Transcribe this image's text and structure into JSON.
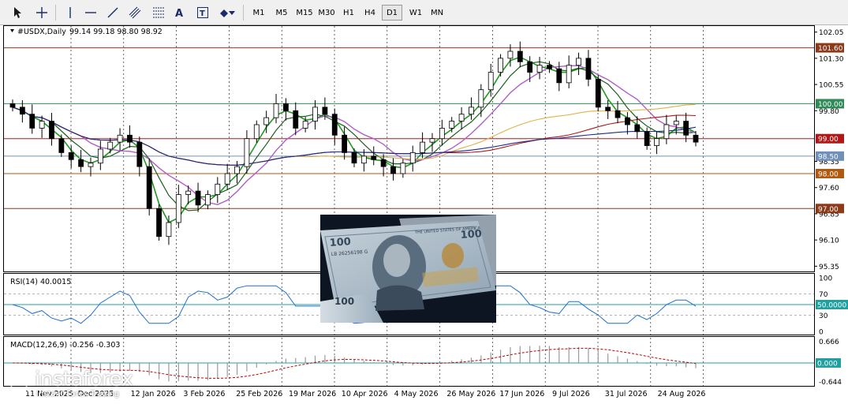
{
  "toolbar": {
    "timeframes": [
      "M1",
      "M5",
      "M15",
      "M30",
      "H1",
      "H4",
      "D1",
      "W1",
      "MN"
    ],
    "active_timeframe": "D1",
    "tools": [
      "cursor-icon",
      "crosshair-icon",
      "vertical-line-icon",
      "horizontal-line-icon",
      "trend-line-icon",
      "channel-icon",
      "fibonacci-icon",
      "text-icon",
      "label-icon",
      "shapes-icon"
    ]
  },
  "main_chart": {
    "symbol_label": "#USDX,Daily",
    "ohlc_label": "99.14 99.18 98.80 98.92",
    "price_ticks": [
      "102.05",
      "101.30",
      "100.55",
      "99.80",
      "98.35",
      "97.60",
      "96.85",
      "96.10",
      "95.35"
    ],
    "level_labels": [
      {
        "text": "101.60",
        "price": 101.6,
        "color": "#8b3a1a"
      },
      {
        "text": "100.00",
        "price": 100.0,
        "color": "#2e8b57"
      },
      {
        "text": "99.00",
        "price": 99.0,
        "color": "#b01818"
      },
      {
        "text": "98.50",
        "price": 98.5,
        "color": "#7090b8"
      },
      {
        "text": "98.00",
        "price": 98.0,
        "color": "#b05a10"
      },
      {
        "text": "97.00",
        "price": 97.0,
        "color": "#8b3a1a"
      }
    ],
    "price_range": [
      95.2,
      102.2
    ]
  },
  "rsi": {
    "label": "RSI(14) 40.0015",
    "ticks": [
      "100",
      "70",
      "30",
      "0"
    ],
    "level_label": "50.0000",
    "range": [
      0,
      100
    ]
  },
  "macd": {
    "label": "MACD(12,26,9) -0.256 -0.303",
    "ticks": [
      "0.666",
      "-0.644"
    ],
    "zero_label": "0.000"
  },
  "time_axis": [
    "11 Nov 2025",
    "Dec 2025",
    "12 Jan 2026",
    "3 Feb 2026",
    "25 Feb 2026",
    "19 Mar 2026",
    "10 Apr 2026",
    "4 May 2026",
    "26 May 2026",
    "17 Jun 2026",
    "9 Jul 2026",
    "31 Jul 2026",
    "24 Aug 2026"
  ],
  "photo": {
    "note_denomination": "100",
    "note_serial": "LB 26256198 G",
    "note_text": "THE UNITED STATES OF AMERICA"
  },
  "logo": {
    "name": "instaforex",
    "tagline": "Instant Forex Trading"
  },
  "chart_data": {
    "type": "candlestick",
    "series_close_approx": [
      99.9,
      99.7,
      99.3,
      99.5,
      99.0,
      98.6,
      98.4,
      98.2,
      98.3,
      98.7,
      98.9,
      99.1,
      98.9,
      98.2,
      97.0,
      96.2,
      96.6,
      97.4,
      97.5,
      97.1,
      97.4,
      97.7,
      98.0,
      98.2,
      99.0,
      99.4,
      99.6,
      100.0,
      99.8,
      99.3,
      99.5,
      99.9,
      99.7,
      99.1,
      98.6,
      98.3,
      98.5,
      98.4,
      98.2,
      98.0,
      98.3,
      98.6,
      98.9,
      99.0,
      99.3,
      99.5,
      99.7,
      99.9,
      100.4,
      100.9,
      101.3,
      101.5,
      101.2,
      100.9,
      101.1,
      101.0,
      100.6,
      101.1,
      101.3,
      100.7,
      99.9,
      99.8,
      99.6,
      99.4,
      99.2,
      98.8,
      99.0,
      99.4,
      99.5,
      99.1,
      98.9
    ],
    "price_levels": [
      101.6,
      100.0,
      99.0,
      98.5,
      98.0,
      97.0
    ],
    "ylim": [
      95.35,
      102.05
    ]
  }
}
